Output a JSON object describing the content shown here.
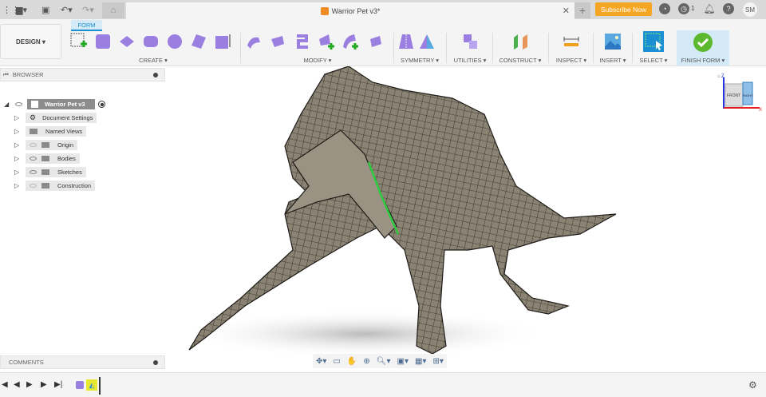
{
  "topbar": {
    "document_title": "Warrior Pet v3*",
    "subscribe_label": "Subscribe Now",
    "jobs_count": "1",
    "user_initials": "SM"
  },
  "toolbar": {
    "active_tab": "FORM",
    "workspace": "DESIGN",
    "groups": [
      "CREATE",
      "MODIFY",
      "SYMMETRY",
      "UTILITIES",
      "CONSTRUCT",
      "INSPECT",
      "INSERT",
      "SELECT",
      "FINISH FORM"
    ]
  },
  "browser": {
    "title": "BROWSER",
    "root": "Warrior Pet v3",
    "items": [
      "Document Settings",
      "Named Views",
      "Origin",
      "Bodies",
      "Sketches",
      "Construction"
    ]
  },
  "comments": {
    "title": "COMMENTS"
  },
  "viewcube": {
    "front": "FRONT",
    "right": "RIGHT",
    "axis_x": "X",
    "axis_z": "Z"
  },
  "colors": {
    "accent": "#1a8fd1",
    "subscribe": "#f5a623",
    "form_purple": "#9b7fe0",
    "finish_green": "#5cb82e"
  }
}
